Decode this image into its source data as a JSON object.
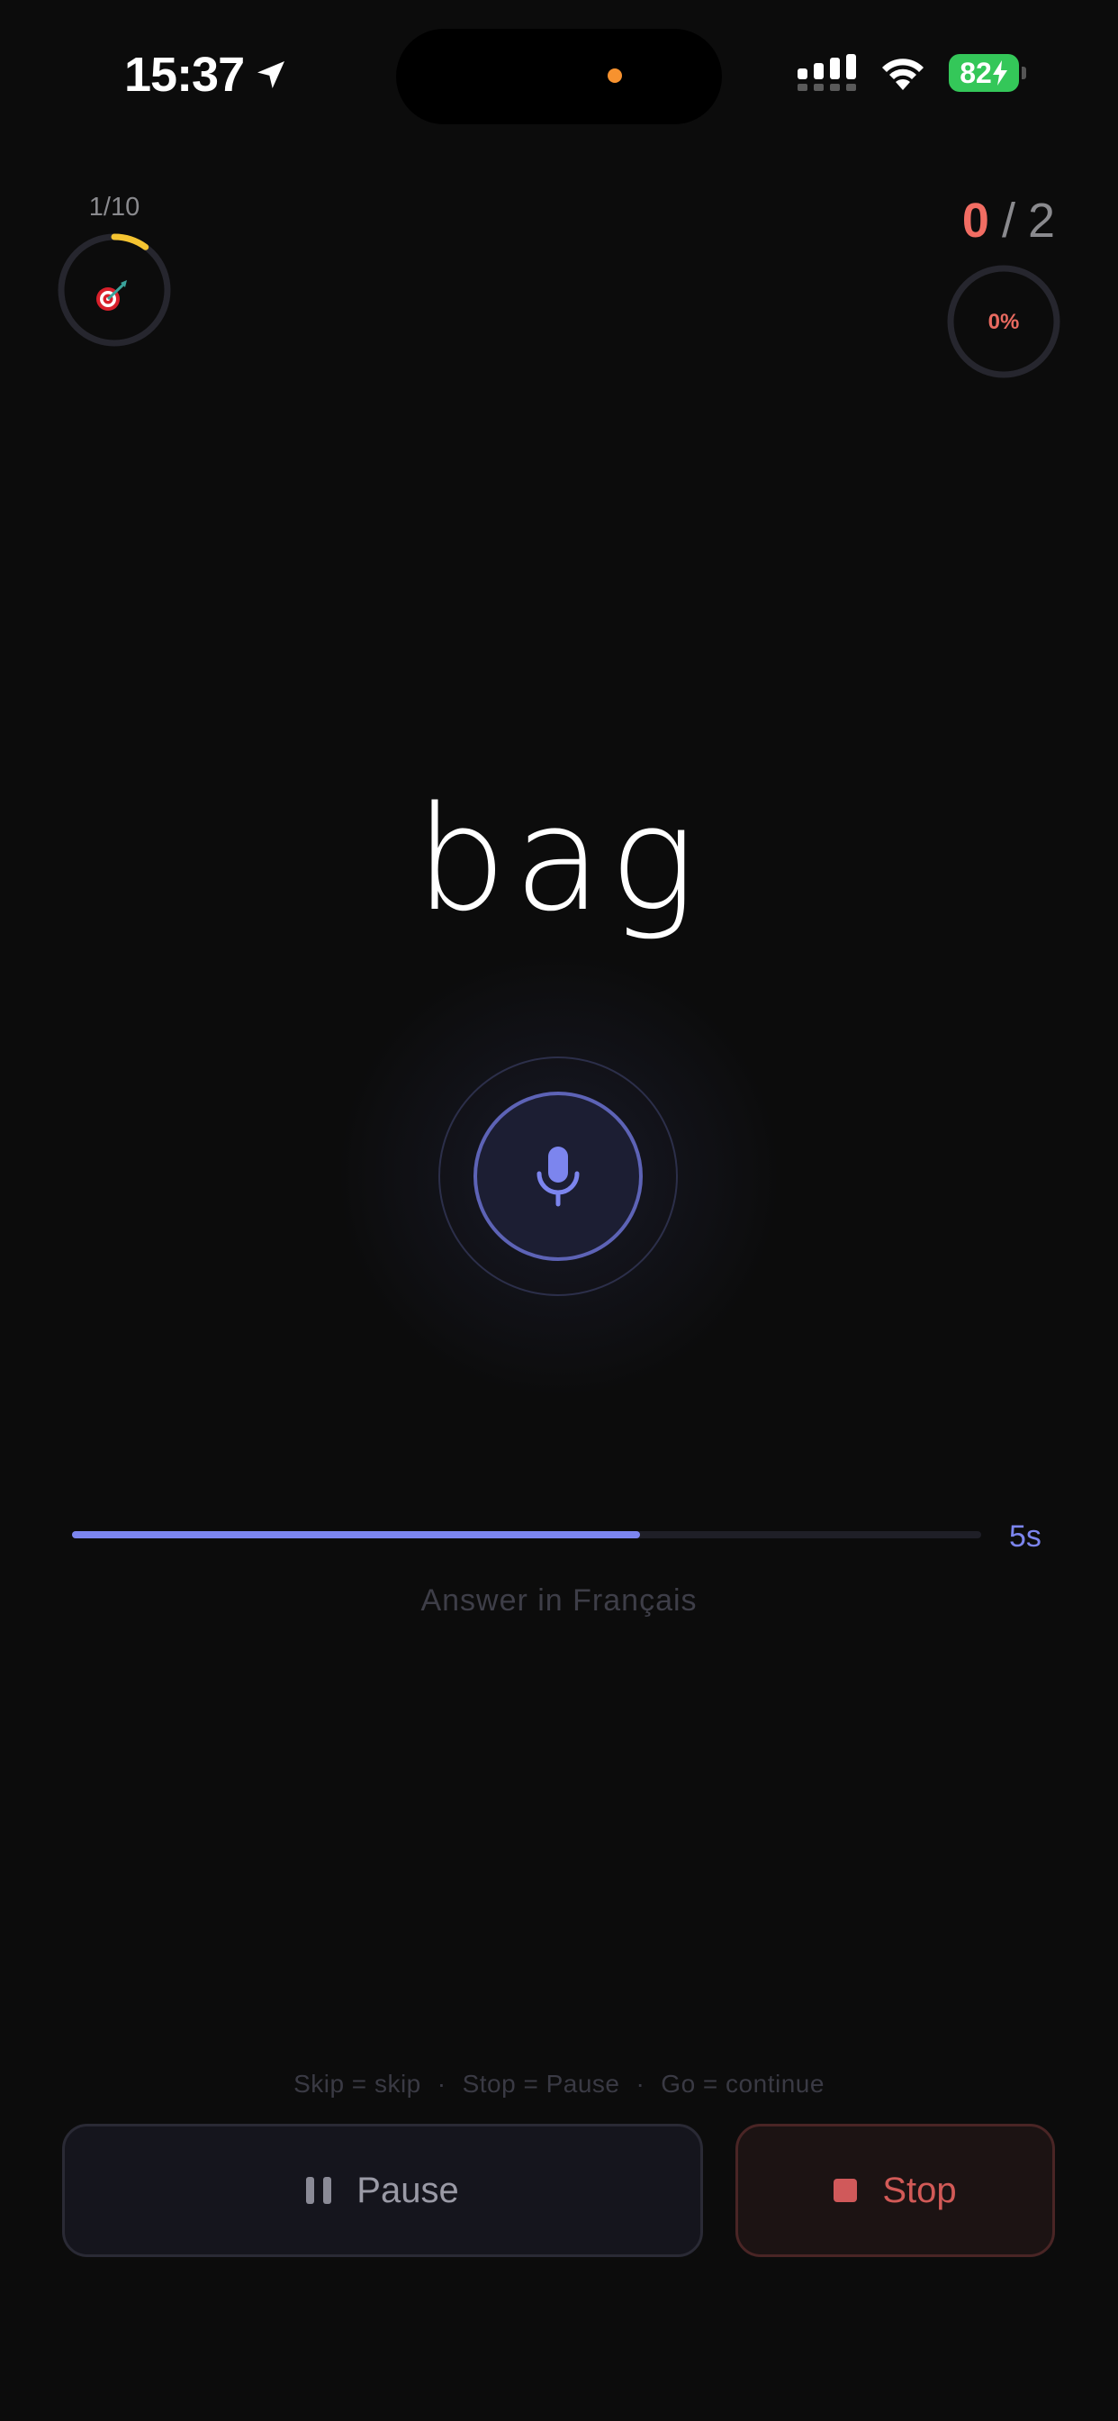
{
  "status_bar": {
    "time": "15:37",
    "battery": "82",
    "icons": [
      "location-arrow-icon",
      "cellular-signal-icon",
      "wifi-icon",
      "battery-charging-icon"
    ]
  },
  "progress": {
    "question_label": "1/10",
    "fraction_complete": 0.1,
    "icon": "target-dart-icon"
  },
  "score": {
    "correct": "0",
    "separator": "/",
    "total": "2",
    "percent": "0%"
  },
  "prompt": {
    "word": "bag"
  },
  "mic": {
    "icon": "microphone-icon"
  },
  "timer": {
    "label": "5s",
    "fraction_remaining": 0.625
  },
  "hint": "Answer in Français",
  "shortcuts": {
    "skip": "Skip = skip",
    "stop": "Stop = Pause",
    "go": "Go = continue",
    "separator": "·"
  },
  "buttons": {
    "pause_label": "Pause",
    "stop_label": "Stop"
  },
  "colors": {
    "accent": "#7c85ee",
    "progress_ring": "#f5c431",
    "score_correct": "#f26d63",
    "stop": "#d25a57",
    "battery": "#34c759"
  }
}
